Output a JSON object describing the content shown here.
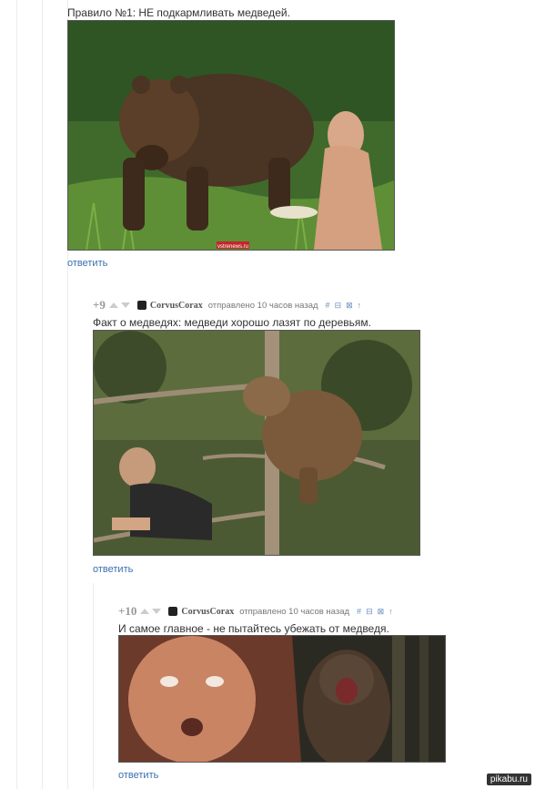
{
  "comments": [
    {
      "text": "Правило №1: НЕ подкармливать медведей.",
      "reply": "ответить",
      "photo_tag": "vstrenews.ru"
    },
    {
      "rating": "+9",
      "author": "CorvusCorax",
      "posted": "отправлено 10 часов назад",
      "tools": [
        "#",
        "⊟",
        "⊠",
        "↑"
      ],
      "text": "Факт о медведях: медведи хорошо лазят по деревьям.",
      "reply": "ответить"
    },
    {
      "rating": "+10",
      "author": "CorvusCorax",
      "posted": "отправлено 10 часов назад",
      "tools": [
        "#",
        "⊟",
        "⊠",
        "↑"
      ],
      "text": "И самое главное - не пытайтесь убежать от медведя.",
      "reply": "ответить"
    }
  ],
  "watermark": "pikabu.ru"
}
